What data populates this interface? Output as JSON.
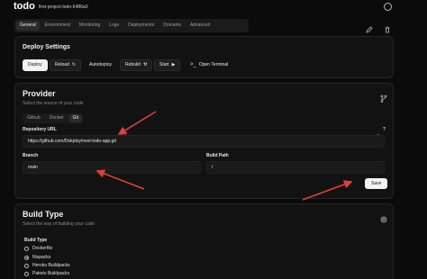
{
  "app": {
    "logo": "todo",
    "project": "first-project-todo-6486a0"
  },
  "main_tabs": [
    "General",
    "Environment",
    "Monitoring",
    "Logs",
    "Deployments",
    "Domains",
    "Advanced"
  ],
  "deploy_settings": {
    "title": "Deploy Settings",
    "deploy": "Deploy",
    "reload": "Reload",
    "autodeploy": "Autodeploy",
    "rebuild": "Rebuild",
    "start": "Start",
    "open_terminal": "Open Terminal"
  },
  "provider": {
    "title": "Provider",
    "subtitle": "Select the source of your code",
    "tabs": [
      "Github",
      "Docker",
      "Git"
    ],
    "repo_label": "Repository URL",
    "repo_value": "https://github.com/Dokploy/next-todo-app.git",
    "help_icon_text": "?",
    "branch_label": "Branch",
    "branch_value": "main",
    "build_path_label": "Build Path",
    "build_path_value": "/",
    "save": "Save"
  },
  "build_type": {
    "title": "Build Type",
    "subtitle": "Select the way of building your code",
    "label": "Build Type",
    "options": [
      "Dockerfile",
      "Nixpacks",
      "Heroku Buildpacks",
      "Paketo Buildpacks"
    ],
    "selected": 1
  },
  "colors": {
    "background": "#0b0b0b",
    "card": "#121212",
    "annotation_arrow": "#e0403a"
  }
}
